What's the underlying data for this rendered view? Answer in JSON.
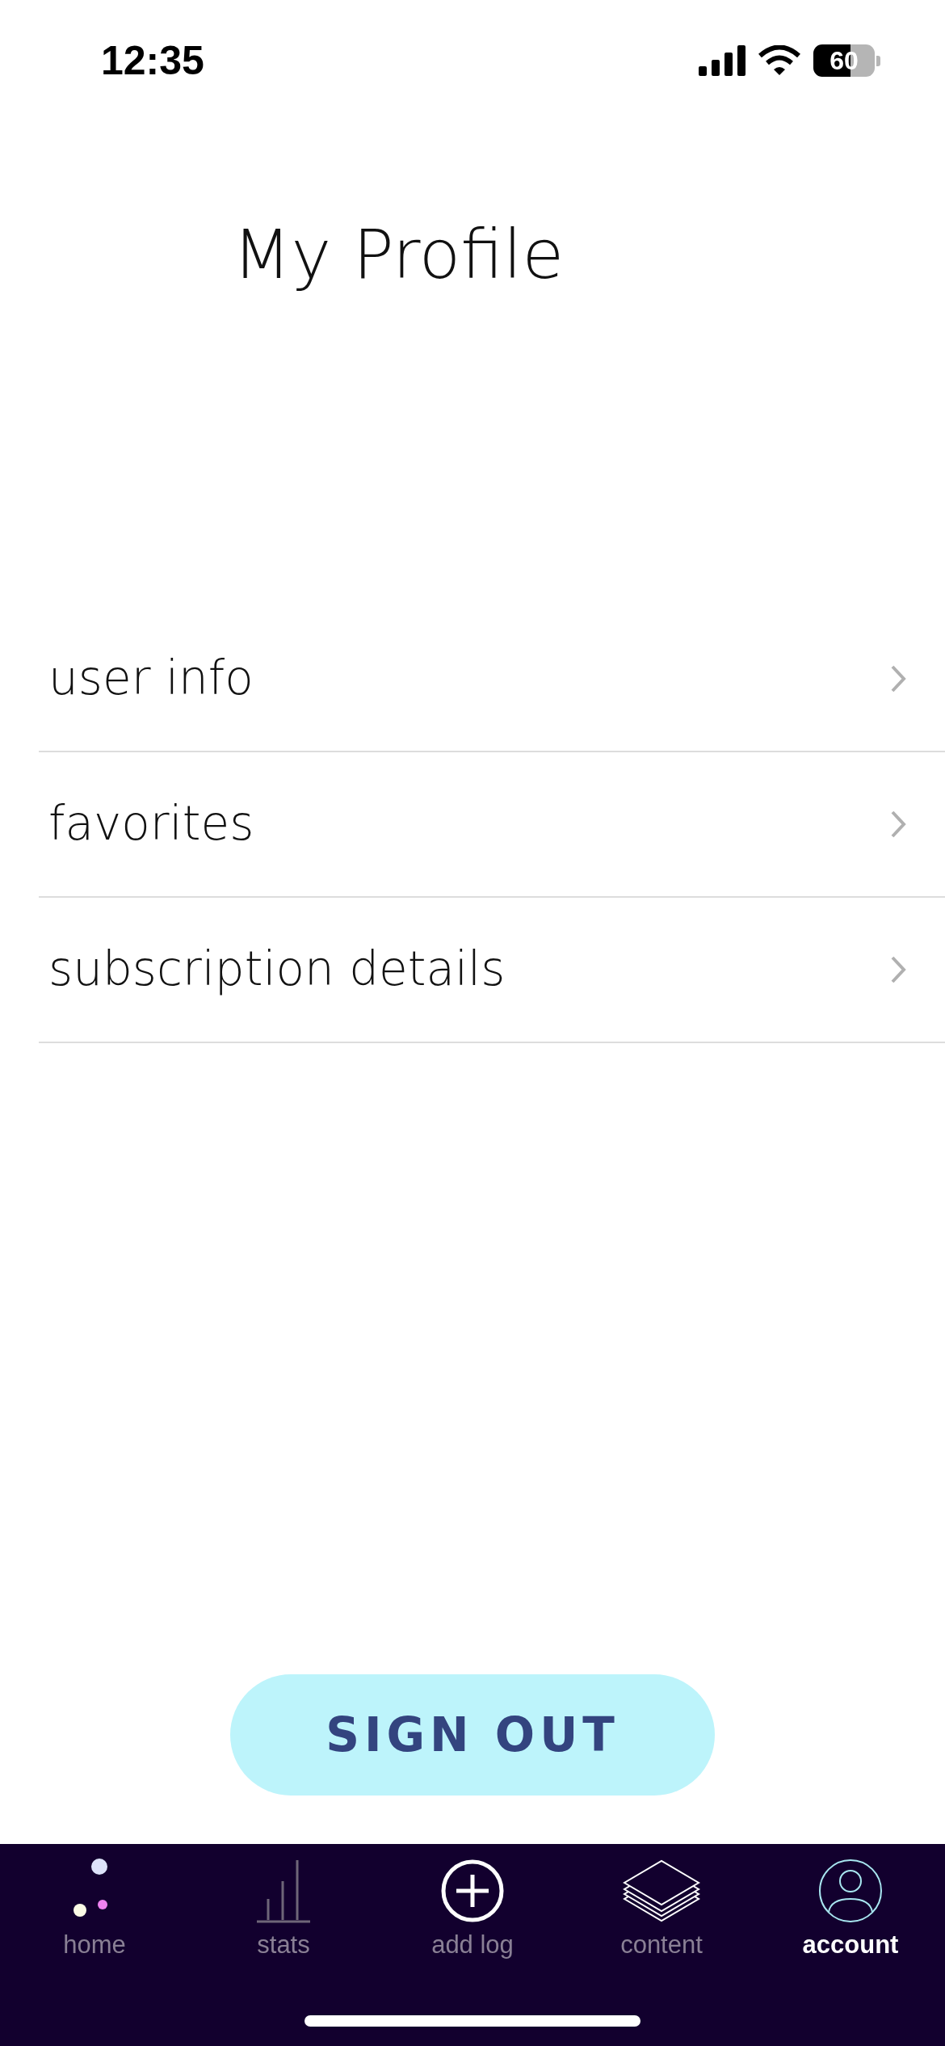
{
  "status_bar": {
    "time": "12:35",
    "battery": "60"
  },
  "title": "My Profile",
  "menu": [
    {
      "label": "user info"
    },
    {
      "label": "favorites"
    },
    {
      "label": "subscription details"
    }
  ],
  "sign_out": "SIGN OUT",
  "tab_bar": [
    {
      "kind": "home",
      "label": "home",
      "selected": false
    },
    {
      "kind": "stats",
      "label": "stats",
      "selected": false
    },
    {
      "kind": "add",
      "label": "add log",
      "selected": false
    },
    {
      "kind": "content",
      "label": "content",
      "selected": false
    },
    {
      "kind": "account",
      "label": "account",
      "selected": true
    }
  ]
}
